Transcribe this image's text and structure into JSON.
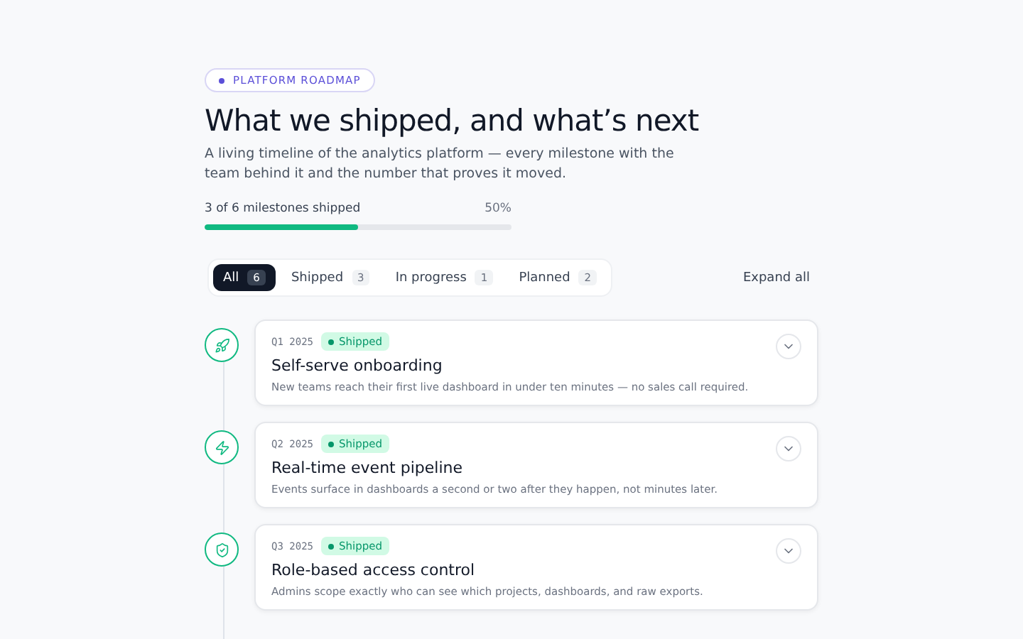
{
  "eyebrow": "PLATFORM ROADMAP",
  "title": "What we shipped, and what’s next",
  "subtitle": "A living timeline of the analytics platform — every milestone with the team behind it and the number that proves it moved.",
  "progress": {
    "label": "3 of 6 milestones shipped",
    "reading": "50%",
    "level": 0.5
  },
  "filters": [
    {
      "label": "All",
      "count": "6",
      "selected": true
    },
    {
      "label": "Shipped",
      "count": "3",
      "selected": false
    },
    {
      "label": "In progress",
      "count": "1",
      "selected": false
    },
    {
      "label": "Planned",
      "count": "2",
      "selected": false
    }
  ],
  "expand_all": "Expand all",
  "milestones": [
    {
      "kind": "rocket",
      "quarter": "Q1 2025",
      "status": {
        "kind": "shipped",
        "label": "Shipped"
      },
      "title": "Self-serve onboarding",
      "description": "New teams reach their first live dashboard in under ten minutes — no sales call required."
    },
    {
      "kind": "zap",
      "quarter": "Q2 2025",
      "status": {
        "kind": "shipped",
        "label": "Shipped"
      },
      "title": "Real-time event pipeline",
      "description": "Events surface in dashboards a second or two after they happen, not minutes later."
    },
    {
      "kind": "shield",
      "quarter": "Q3 2025",
      "status": {
        "kind": "shipped",
        "label": "Shipped"
      },
      "title": "Role-based access control",
      "description": "Admins scope exactly who can see which projects, dashboards, and raw exports."
    }
  ]
}
